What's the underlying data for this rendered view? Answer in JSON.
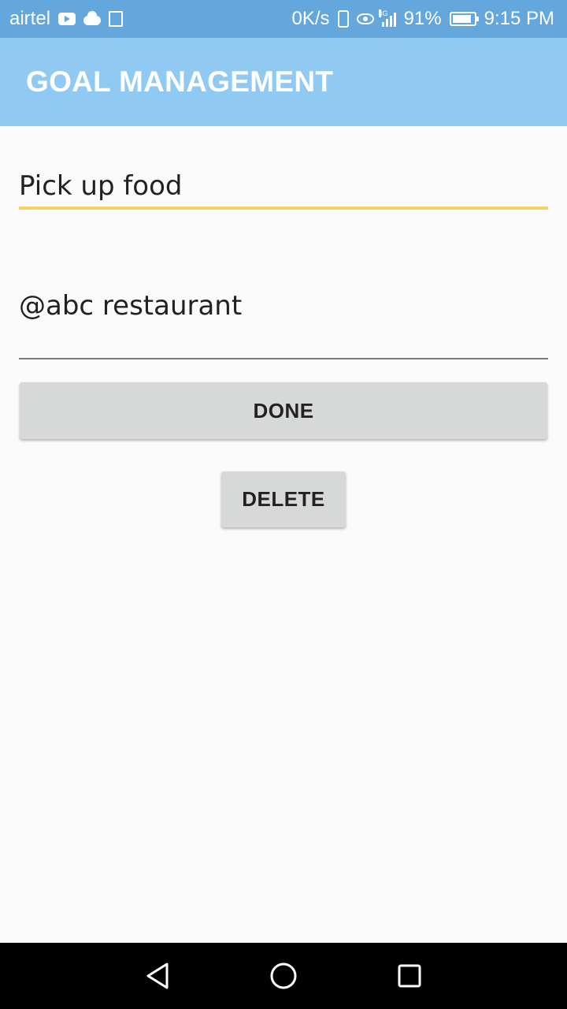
{
  "status_bar": {
    "carrier": "airtel",
    "speed": "0K/s",
    "network": "4G",
    "battery": "91%",
    "battery_level": 0.91,
    "time": "9:15 PM",
    "icons": [
      "youtube-icon",
      "cloud-icon",
      "map-icon",
      "vibrate-icon",
      "eye-icon",
      "signal-icon",
      "battery-icon"
    ]
  },
  "app_bar": {
    "title": "GOAL MANAGEMENT",
    "background": "#90caf2"
  },
  "form": {
    "title_value": "Pick up food",
    "location_value": "@abc restaurant",
    "focus_underline_color": "#f2d260"
  },
  "actions": {
    "done_label": "DONE",
    "delete_label": "DELETE"
  },
  "nav_bar": {
    "icons": [
      "back-icon",
      "home-icon",
      "recents-icon"
    ]
  }
}
